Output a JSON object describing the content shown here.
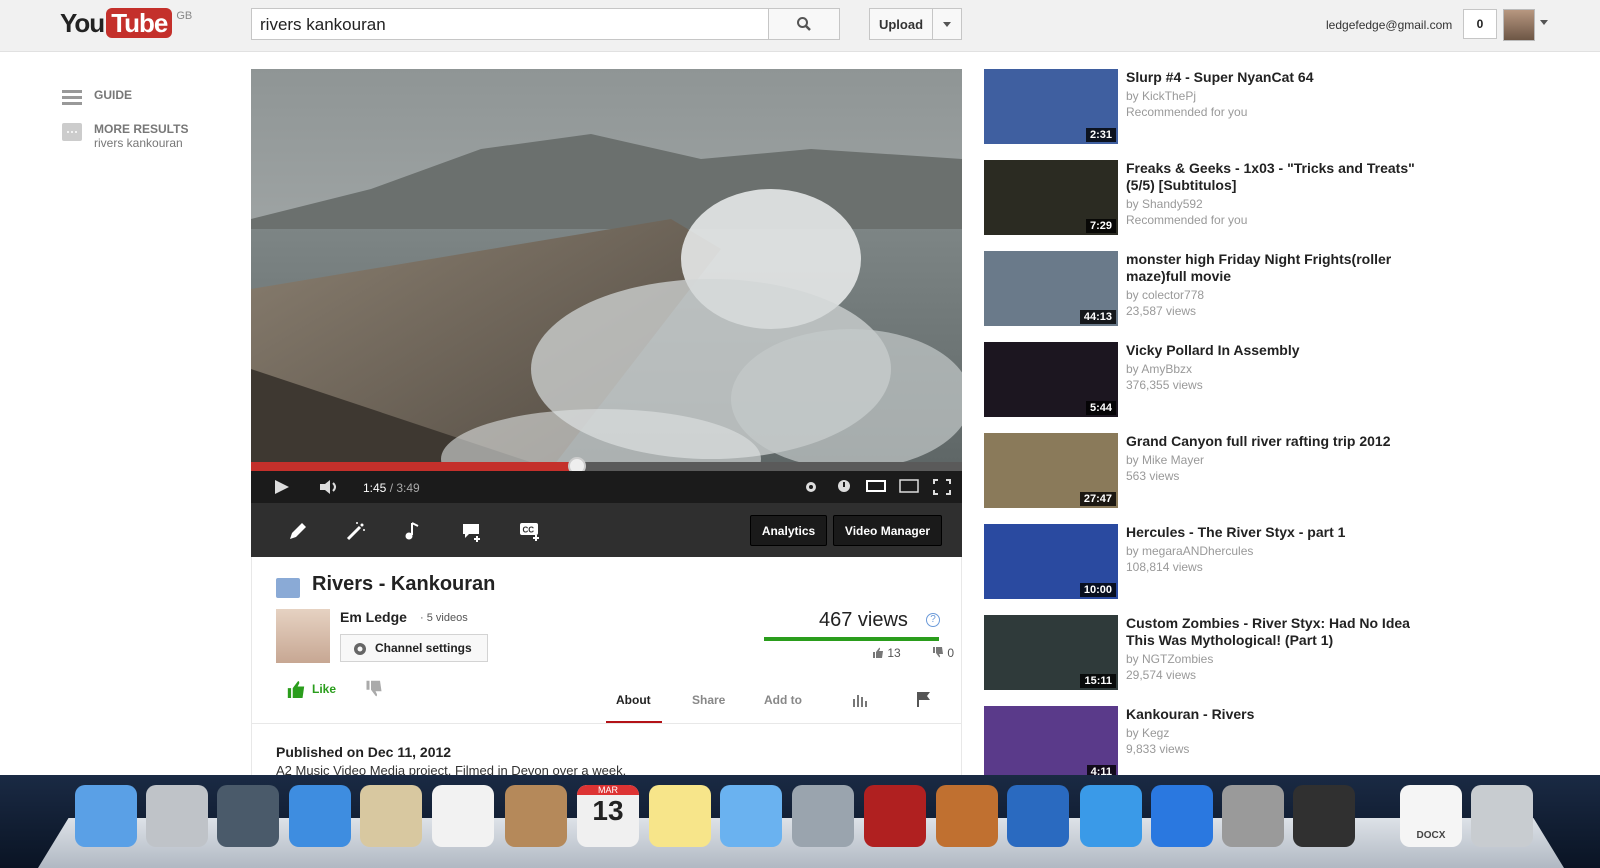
{
  "masthead": {
    "logo_you": "You",
    "logo_tube": "Tube",
    "logo_region": "GB",
    "search_value": "rivers kankouran",
    "upload_label": "Upload",
    "account_email": "ledgefedge@gmail.com",
    "notification_count": "0"
  },
  "guide": {
    "items": [
      {
        "label": "GUIDE",
        "sub": ""
      },
      {
        "label": "MORE RESULTS",
        "sub": "rivers kankouran"
      }
    ]
  },
  "player": {
    "current_time": "1:45",
    "separator": " / ",
    "duration": "3:49",
    "progress_fraction": 0.458
  },
  "editbar": {
    "analytics_label": "Analytics",
    "video_manager_label": "Video Manager"
  },
  "watch": {
    "title": "Rivers - Kankouran",
    "channel_name": "Em Ledge",
    "channel_videos": "· 5 videos",
    "channel_settings_label": "Channel settings",
    "views": "467 views",
    "help_glyph": "?",
    "likes": "13",
    "dislikes": "0",
    "like_label": "Like",
    "tabs": [
      "About",
      "Share",
      "Add to"
    ],
    "published": "Published on Dec 11, 2012",
    "description": "A2 Music Video Media project. Filmed in Devon over a week."
  },
  "related": [
    {
      "title": "Slurp #4 - Super NyanCat 64",
      "by": "by KickThePj",
      "meta": "Recommended for you",
      "duration": "2:31",
      "color": "#3f5fa0"
    },
    {
      "title": "Freaks & Geeks - 1x03 - \"Tricks and Treats\" (5/5) [Subtitulos]",
      "by": "by Shandy592",
      "meta": "Recommended for you",
      "duration": "7:29",
      "color": "#2b2b22"
    },
    {
      "title": "monster high Friday Night Frights(roller maze)full movie",
      "by": "by colector778",
      "meta": "23,587 views",
      "duration": "44:13",
      "color": "#6a7a8a"
    },
    {
      "title": "Vicky Pollard In Assembly",
      "by": "by AmyBbzx",
      "meta": "376,355 views",
      "duration": "5:44",
      "color": "#1c1620"
    },
    {
      "title": "Grand Canyon full river rafting trip 2012",
      "by": "by Mike Mayer",
      "meta": "563 views",
      "duration": "27:47",
      "color": "#8a7a5a"
    },
    {
      "title": "Hercules - The River Styx - part 1",
      "by": "by megaraANDhercules",
      "meta": "108,814 views",
      "duration": "10:00",
      "color": "#2a4aa0"
    },
    {
      "title": "Custom Zombies - River Styx: Had No Idea This Was Mythological! (Part 1)",
      "by": "by NGTZombies",
      "meta": "29,574 views",
      "duration": "15:11",
      "color": "#2f3a3a"
    },
    {
      "title": "Kankouran - Rivers",
      "by": "by Kegz",
      "meta": "9,833 views",
      "duration": "4:11",
      "color": "#5a3a8a"
    }
  ],
  "dock": {
    "apps": [
      "finder-icon",
      "launchpad-icon",
      "photo-browser-icon",
      "safari-icon",
      "mail-icon",
      "reminders-icon",
      "contacts-icon",
      "calendar-icon",
      "stickies-icon",
      "messages-icon",
      "facetime-icon",
      "photo-booth-icon",
      "iphoto-icon",
      "quicktime-icon",
      "itunes-icon",
      "app-store-icon",
      "system-preferences-icon",
      "final-cut-icon",
      "docx-file-icon",
      "trash-icon"
    ],
    "calendar_month": "MAR",
    "calendar_day": "13",
    "docx_label": "DOCX"
  }
}
